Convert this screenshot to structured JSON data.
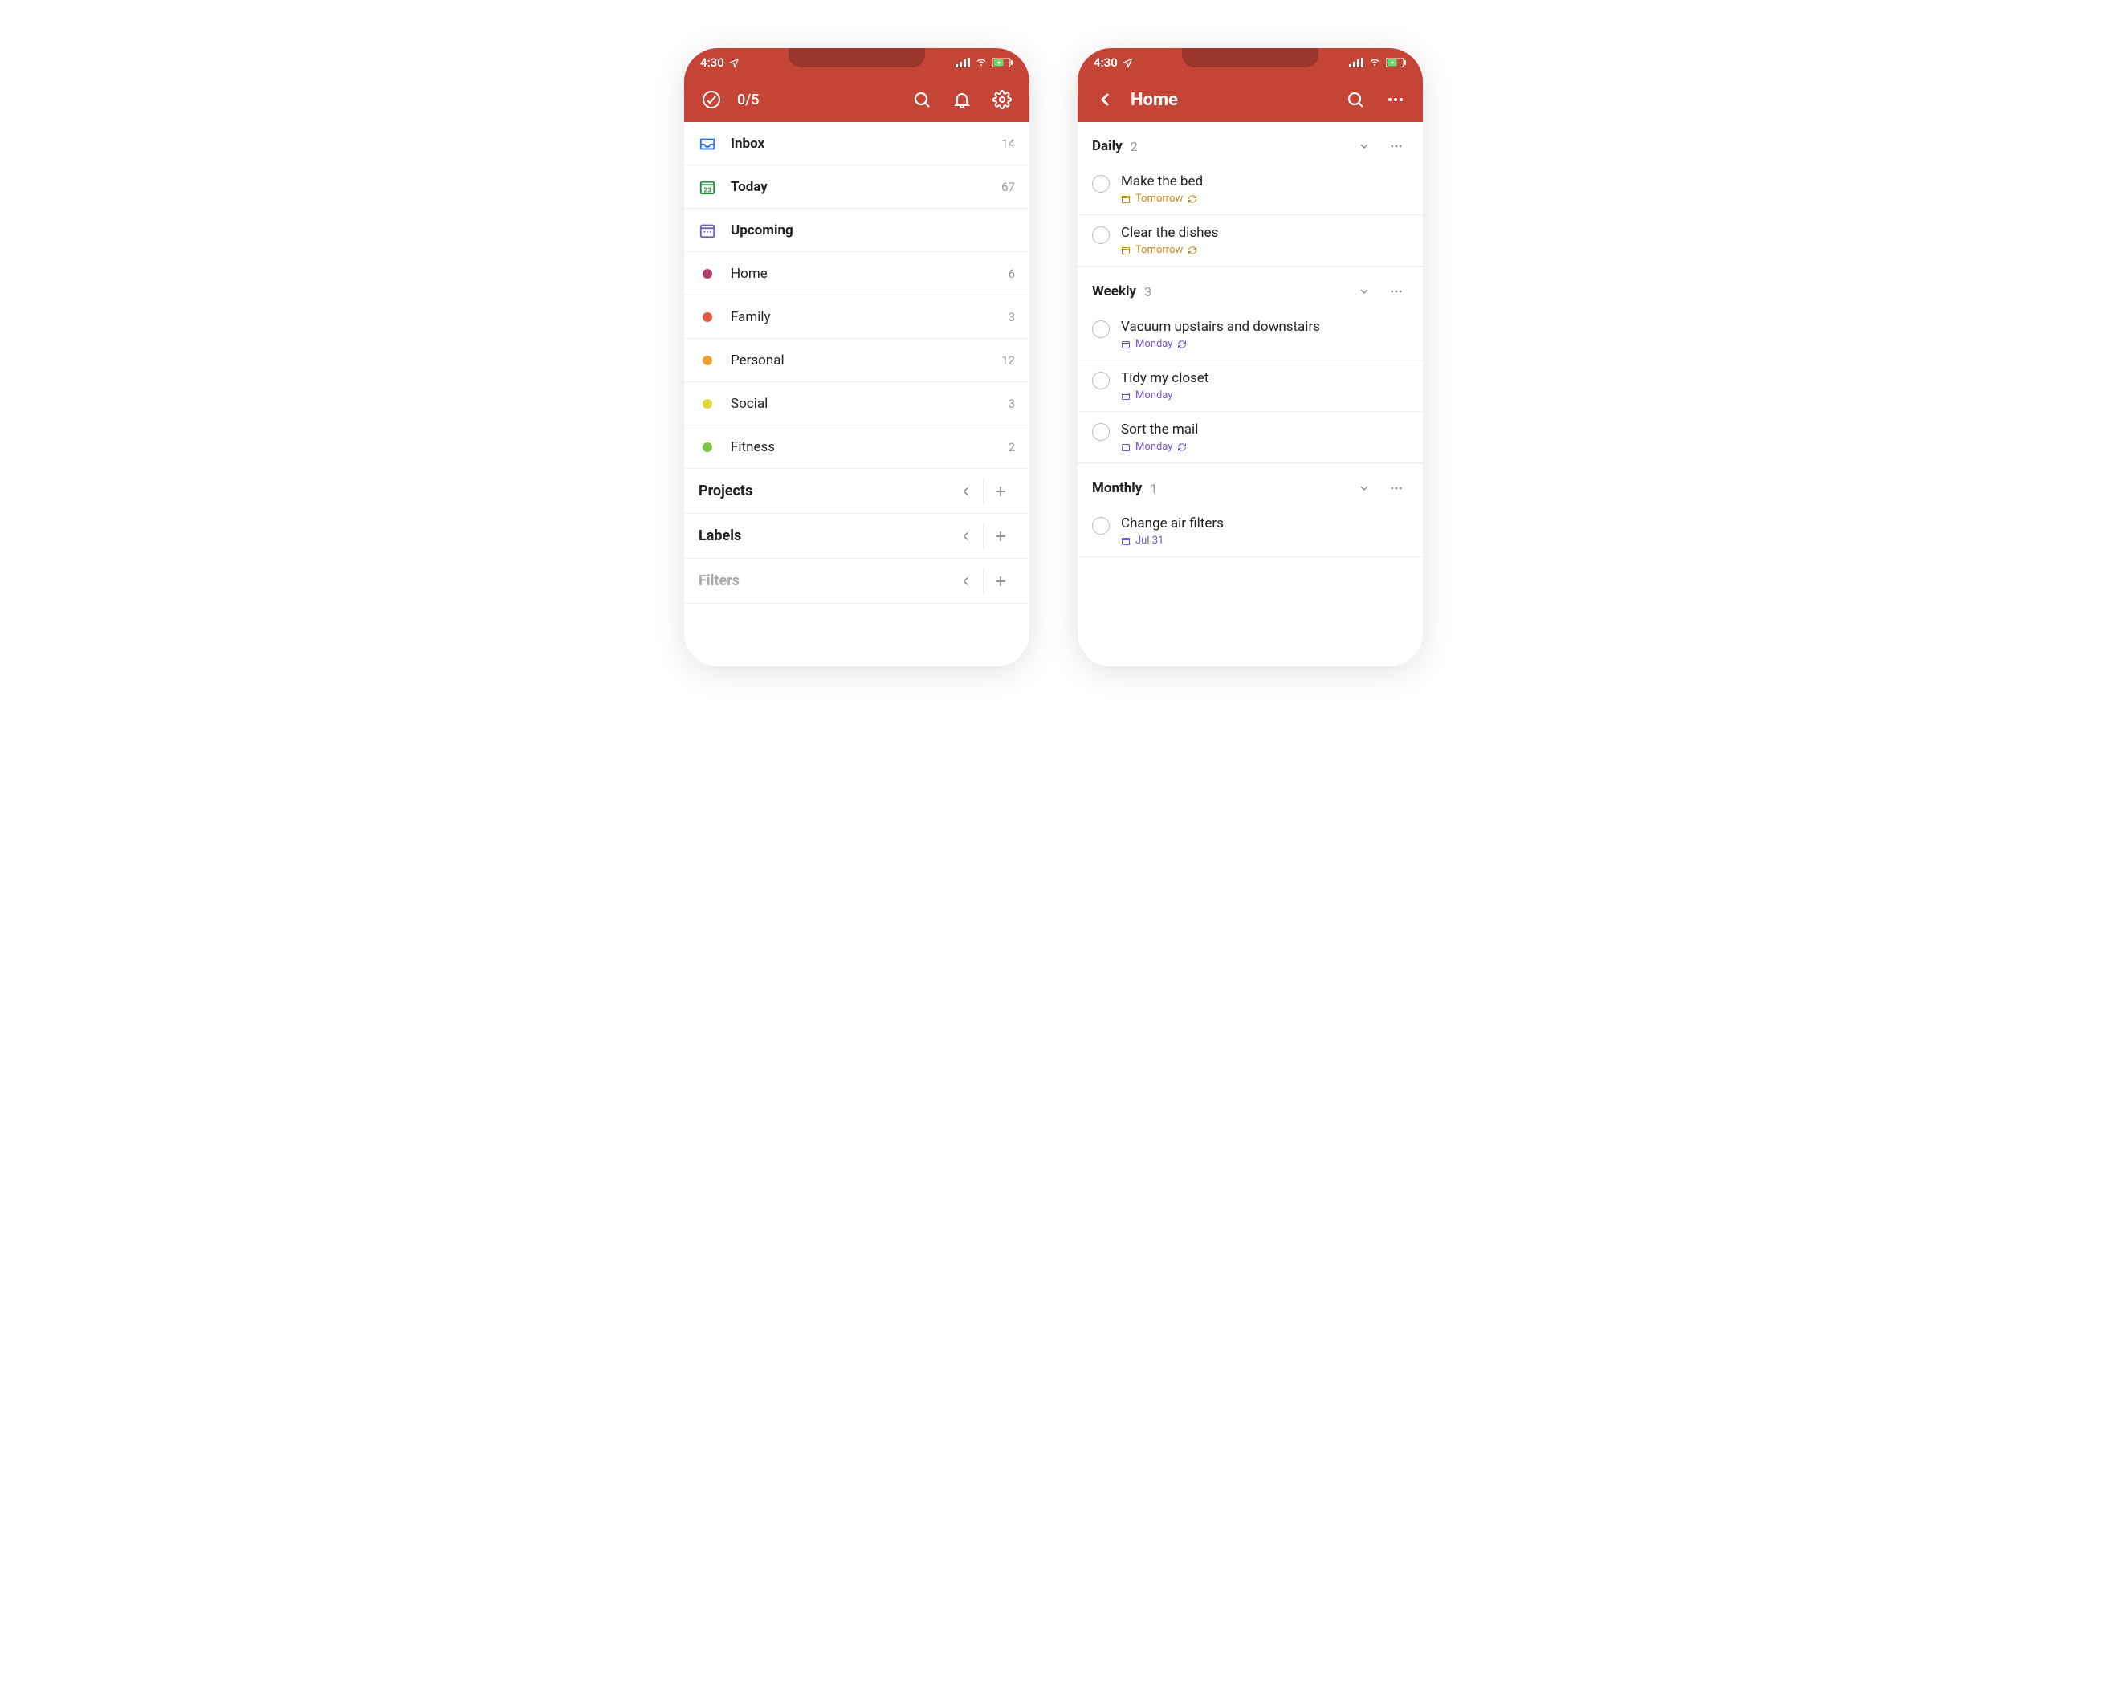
{
  "status": {
    "time": "4:30",
    "location_icon": "location-arrow-icon",
    "signal_icon": "signal-icon",
    "wifi_icon": "wifi-icon",
    "battery_icon": "battery-charging-icon"
  },
  "left": {
    "toolbar": {
      "productivity_icon": "productivity-icon",
      "progress": "0/5",
      "search_icon": "search-icon",
      "notifications_icon": "bell-icon",
      "settings_icon": "gear-icon"
    },
    "views": [
      {
        "icon": "inbox-icon",
        "label": "Inbox",
        "count": "14",
        "color": "#2f6fed",
        "bold": true
      },
      {
        "icon": "calendar-today-icon",
        "label": "Today",
        "count": "67",
        "color": "#1f8a3b",
        "bold": true,
        "day": "23"
      },
      {
        "icon": "calendar-upcoming-icon",
        "label": "Upcoming",
        "count": "",
        "color": "#6e56cf",
        "bold": true
      }
    ],
    "projects": [
      {
        "label": "Home",
        "count": "6",
        "dot": "#b53d6c"
      },
      {
        "label": "Family",
        "count": "3",
        "dot": "#e05b3a"
      },
      {
        "label": "Personal",
        "count": "12",
        "dot": "#f0a02c"
      },
      {
        "label": "Social",
        "count": "3",
        "dot": "#e6d738"
      },
      {
        "label": "Fitness",
        "count": "2",
        "dot": "#7bc642"
      }
    ],
    "sections": [
      {
        "label": "Projects",
        "muted": false
      },
      {
        "label": "Labels",
        "muted": false
      },
      {
        "label": "Filters",
        "muted": true
      }
    ]
  },
  "right": {
    "toolbar": {
      "back_icon": "chevron-left-icon",
      "title": "Home",
      "search_icon": "search-icon",
      "more_icon": "more-horizontal-icon"
    },
    "groups": [
      {
        "title": "Daily",
        "count": "2",
        "tasks": [
          {
            "title": "Make the bed",
            "due": "Tomorrow",
            "recur": true,
            "color": "orange"
          },
          {
            "title": "Clear the dishes",
            "due": "Tomorrow",
            "recur": true,
            "color": "orange"
          }
        ]
      },
      {
        "title": "Weekly",
        "count": "3",
        "tasks": [
          {
            "title": "Vacuum upstairs and downstairs",
            "due": "Monday",
            "recur": true,
            "color": "purple"
          },
          {
            "title": "Tidy my closet",
            "due": "Monday",
            "recur": false,
            "color": "purple"
          },
          {
            "title": "Sort the mail",
            "due": "Monday",
            "recur": true,
            "color": "purple"
          }
        ]
      },
      {
        "title": "Monthly",
        "count": "1",
        "tasks": [
          {
            "title": "Change air filters",
            "due": "Jul 31",
            "recur": false,
            "color": "purple"
          }
        ]
      }
    ]
  }
}
